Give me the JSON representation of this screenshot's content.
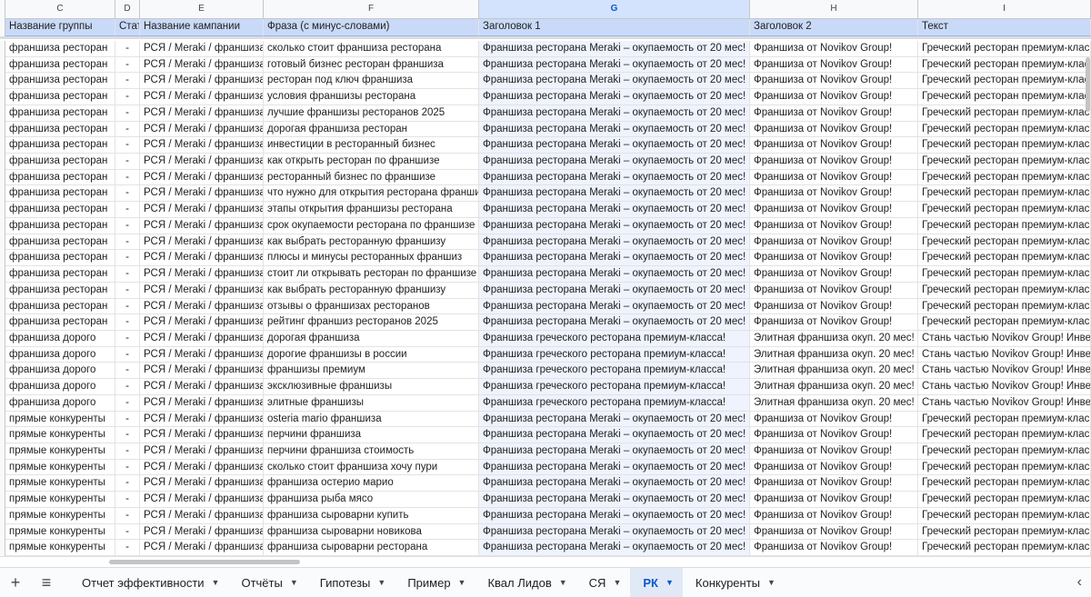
{
  "columns": [
    {
      "letter": "C",
      "header": "Название группы",
      "key": "c"
    },
    {
      "letter": "D",
      "header": "Стат",
      "key": "d"
    },
    {
      "letter": "E",
      "header": "Название кампании",
      "key": "e"
    },
    {
      "letter": "F",
      "header": "Фраза (с минус-словами)",
      "key": "f"
    },
    {
      "letter": "G",
      "header": "Заголовок 1",
      "key": "g"
    },
    {
      "letter": "H",
      "header": "Заголовок 2",
      "key": "h"
    },
    {
      "letter": "I",
      "header": "Текст",
      "key": "i"
    }
  ],
  "selected_column": "G",
  "rows": [
    {
      "c": "франшиза ресторан",
      "d": "-",
      "e": "РСЯ / Meraki / франшиза",
      "f": "сколько стоит франшиза ресторана",
      "g": "Франшиза ресторана Meraki – окупаемость от 20 мес!",
      "h": "Франшиза от Novikov Group!",
      "i": "Греческий ресторан премиум-клас"
    },
    {
      "c": "франшиза ресторан",
      "d": "-",
      "e": "РСЯ / Meraki / франшиза",
      "f": "готовый бизнес ресторан франшиза",
      "g": "Франшиза ресторана Meraki – окупаемость от 20 мес!",
      "h": "Франшиза от Novikov Group!",
      "i": "Греческий ресторан премиум-клас"
    },
    {
      "c": "франшиза ресторан",
      "d": "-",
      "e": "РСЯ / Meraki / франшиза",
      "f": "ресторан под ключ франшиза",
      "g": "Франшиза ресторана Meraki – окупаемость от 20 мес!",
      "h": "Франшиза от Novikov Group!",
      "i": "Греческий ресторан премиум-клас"
    },
    {
      "c": "франшиза ресторан",
      "d": "-",
      "e": "РСЯ / Meraki / франшиза",
      "f": "условия франшизы ресторана",
      "g": "Франшиза ресторана Meraki – окупаемость от 20 мес!",
      "h": "Франшиза от Novikov Group!",
      "i": "Греческий ресторан премиум-клас"
    },
    {
      "c": "франшиза ресторан",
      "d": "-",
      "e": "РСЯ / Meraki / франшиза",
      "f": "лучшие франшизы ресторанов 2025",
      "g": "Франшиза ресторана Meraki – окупаемость от 20 мес!",
      "h": "Франшиза от Novikov Group!",
      "i": "Греческий ресторан премиум-клас"
    },
    {
      "c": "франшиза ресторан",
      "d": "-",
      "e": "РСЯ / Meraki / франшиза",
      "f": "дорогая франшиза ресторан",
      "g": "Франшиза ресторана Meraki – окупаемость от 20 мес!",
      "h": "Франшиза от Novikov Group!",
      "i": "Греческий ресторан премиум-клас"
    },
    {
      "c": "франшиза ресторан",
      "d": "-",
      "e": "РСЯ / Meraki / франшиза",
      "f": "инвестиции в ресторанный бизнес",
      "g": "Франшиза ресторана Meraki – окупаемость от 20 мес!",
      "h": "Франшиза от Novikov Group!",
      "i": "Греческий ресторан премиум-клас"
    },
    {
      "c": "франшиза ресторан",
      "d": "-",
      "e": "РСЯ / Meraki / франшиза",
      "f": "как открыть ресторан по франшизе",
      "g": "Франшиза ресторана Meraki – окупаемость от 20 мес!",
      "h": "Франшиза от Novikov Group!",
      "i": "Греческий ресторан премиум-клас"
    },
    {
      "c": "франшиза ресторан",
      "d": "-",
      "e": "РСЯ / Meraki / франшиза",
      "f": "ресторанный бизнес по франшизе",
      "g": "Франшиза ресторана Meraki – окупаемость от 20 мес!",
      "h": "Франшиза от Novikov Group!",
      "i": "Греческий ресторан премиум-клас"
    },
    {
      "c": "франшиза ресторан",
      "d": "-",
      "e": "РСЯ / Meraki / франшиза",
      "f": "что нужно для открытия ресторана франшиза",
      "g": "Франшиза ресторана Meraki – окупаемость от 20 мес!",
      "h": "Франшиза от Novikov Group!",
      "i": "Греческий ресторан премиум-клас"
    },
    {
      "c": "франшиза ресторан",
      "d": "-",
      "e": "РСЯ / Meraki / франшиза",
      "f": "этапы открытия франшизы ресторана",
      "g": "Франшиза ресторана Meraki – окупаемость от 20 мес!",
      "h": "Франшиза от Novikov Group!",
      "i": "Греческий ресторан премиум-клас"
    },
    {
      "c": "франшиза ресторан",
      "d": "-",
      "e": "РСЯ / Meraki / франшиза",
      "f": "срок окупаемости ресторана по франшизе",
      "g": "Франшиза ресторана Meraki – окупаемость от 20 мес!",
      "h": "Франшиза от Novikov Group!",
      "i": "Греческий ресторан премиум-клас"
    },
    {
      "c": "франшиза ресторан",
      "d": "-",
      "e": "РСЯ / Meraki / франшиза",
      "f": "как выбрать ресторанную франшизу",
      "g": "Франшиза ресторана Meraki – окупаемость от 20 мес!",
      "h": "Франшиза от Novikov Group!",
      "i": "Греческий ресторан премиум-клас"
    },
    {
      "c": "франшиза ресторан",
      "d": "-",
      "e": "РСЯ / Meraki / франшиза",
      "f": "плюсы и минусы ресторанных франшиз",
      "g": "Франшиза ресторана Meraki – окупаемость от 20 мес!",
      "h": "Франшиза от Novikov Group!",
      "i": "Греческий ресторан премиум-клас"
    },
    {
      "c": "франшиза ресторан",
      "d": "-",
      "e": "РСЯ / Meraki / франшиза",
      "f": "стоит ли открывать ресторан по франшизе",
      "g": "Франшиза ресторана Meraki – окупаемость от 20 мес!",
      "h": "Франшиза от Novikov Group!",
      "i": "Греческий ресторан премиум-клас"
    },
    {
      "c": "франшиза ресторан",
      "d": "-",
      "e": "РСЯ / Meraki / франшиза",
      "f": "как выбрать ресторанную франшизу",
      "g": "Франшиза ресторана Meraki – окупаемость от 20 мес!",
      "h": "Франшиза от Novikov Group!",
      "i": "Греческий ресторан премиум-клас"
    },
    {
      "c": "франшиза ресторан",
      "d": "-",
      "e": "РСЯ / Meraki / франшиза",
      "f": "отзывы о франшизах ресторанов",
      "g": "Франшиза ресторана Meraki – окупаемость от 20 мес!",
      "h": "Франшиза от Novikov Group!",
      "i": "Греческий ресторан премиум-клас"
    },
    {
      "c": "франшиза ресторан",
      "d": "-",
      "e": "РСЯ / Meraki / франшиза",
      "f": "рейтинг франшиз ресторанов 2025",
      "g": "Франшиза ресторана Meraki – окупаемость от 20 мес!",
      "h": "Франшиза от Novikov Group!",
      "i": "Греческий ресторан премиум-клас"
    },
    {
      "c": "франшиза дорого",
      "d": "-",
      "e": "РСЯ / Meraki / франшиза",
      "f": "дорогая франшиза",
      "g": "Франшиза греческого ресторана премиум-класса!",
      "h": "Элитная франшиза окуп. 20 мес!",
      "i": "Стань частью Novikov Group! Инве"
    },
    {
      "c": "франшиза дорого",
      "d": "-",
      "e": "РСЯ / Meraki / франшиза",
      "f": "дорогие франшизы в россии",
      "g": "Франшиза греческого ресторана премиум-класса!",
      "h": "Элитная франшиза окуп. 20 мес!",
      "i": "Стань частью Novikov Group! Инве"
    },
    {
      "c": "франшиза дорого",
      "d": "-",
      "e": "РСЯ / Meraki / франшиза",
      "f": "франшизы премиум",
      "g": "Франшиза греческого ресторана премиум-класса!",
      "h": "Элитная франшиза окуп. 20 мес!",
      "i": "Стань частью Novikov Group! Инве"
    },
    {
      "c": "франшиза дорого",
      "d": "-",
      "e": "РСЯ / Meraki / франшиза",
      "f": "эксклюзивные франшизы",
      "g": "Франшиза греческого ресторана премиум-класса!",
      "h": "Элитная франшиза окуп. 20 мес!",
      "i": "Стань частью Novikov Group! Инве"
    },
    {
      "c": "франшиза дорого",
      "d": "-",
      "e": "РСЯ / Meraki / франшиза",
      "f": "элитные франшизы",
      "g": "Франшиза греческого ресторана премиум-класса!",
      "h": "Элитная франшиза окуп. 20 мес!",
      "i": "Стань частью Novikov Group! Инве"
    },
    {
      "c": "прямые конкуренты",
      "d": "-",
      "e": "РСЯ / Meraki / франшиза",
      "f": "osteria mario франшиза",
      "g": "Франшиза ресторана Meraki – окупаемость от 20 мес!",
      "h": "Франшиза от Novikov Group!",
      "i": "Греческий ресторан премиум-клас"
    },
    {
      "c": "прямые конкуренты",
      "d": "-",
      "e": "РСЯ / Meraki / франшиза",
      "f": "перчини франшиза",
      "g": "Франшиза ресторана Meraki – окупаемость от 20 мес!",
      "h": "Франшиза от Novikov Group!",
      "i": "Греческий ресторан премиум-клас"
    },
    {
      "c": "прямые конкуренты",
      "d": "-",
      "e": "РСЯ / Meraki / франшиза",
      "f": "перчини франшиза стоимость",
      "g": "Франшиза ресторана Meraki – окупаемость от 20 мес!",
      "h": "Франшиза от Novikov Group!",
      "i": "Греческий ресторан премиум-клас"
    },
    {
      "c": "прямые конкуренты",
      "d": "-",
      "e": "РСЯ / Meraki / франшиза",
      "f": "сколько стоит франшиза хочу пури",
      "g": "Франшиза ресторана Meraki – окупаемость от 20 мес!",
      "h": "Франшиза от Novikov Group!",
      "i": "Греческий ресторан премиум-клас"
    },
    {
      "c": "прямые конкуренты",
      "d": "-",
      "e": "РСЯ / Meraki / франшиза",
      "f": "франшиза остерио марио",
      "g": "Франшиза ресторана Meraki – окупаемость от 20 мес!",
      "h": "Франшиза от Novikov Group!",
      "i": "Греческий ресторан премиум-клас"
    },
    {
      "c": "прямые конкуренты",
      "d": "-",
      "e": "РСЯ / Meraki / франшиза",
      "f": "франшиза рыба мясо",
      "g": "Франшиза ресторана Meraki – окупаемость от 20 мес!",
      "h": "Франшиза от Novikov Group!",
      "i": "Греческий ресторан премиум-клас"
    },
    {
      "c": "прямые конкуренты",
      "d": "-",
      "e": "РСЯ / Meraki / франшиза",
      "f": "франшиза сыроварни купить",
      "g": "Франшиза ресторана Meraki – окупаемость от 20 мес!",
      "h": "Франшиза от Novikov Group!",
      "i": "Греческий ресторан премиум-клас"
    },
    {
      "c": "прямые конкуренты",
      "d": "-",
      "e": "РСЯ / Meraki / франшиза",
      "f": "франшиза сыроварни новикова",
      "g": "Франшиза ресторана Meraki – окупаемость от 20 мес!",
      "h": "Франшиза от Novikov Group!",
      "i": "Греческий ресторан премиум-клас"
    },
    {
      "c": "прямые конкуренты",
      "d": "-",
      "e": "РСЯ / Meraki / франшиза",
      "f": "франшиза сыроварни ресторана",
      "g": "Франшиза ресторана Meraki – окупаемость от 20 мес!",
      "h": "Франшиза от Novikov Group!",
      "i": "Греческий ресторан премиум-клас"
    }
  ],
  "tabs": [
    {
      "label": "Отчет эффективности",
      "active": false
    },
    {
      "label": "Отчёты",
      "active": false
    },
    {
      "label": "Гипотезы",
      "active": false
    },
    {
      "label": "Пример",
      "active": false
    },
    {
      "label": "Квал Лидов",
      "active": false
    },
    {
      "label": "СЯ",
      "active": false
    },
    {
      "label": "РК",
      "active": true
    },
    {
      "label": "Конкуренты",
      "active": false
    }
  ],
  "toolbar": {
    "add_icon": "plus-icon",
    "all_sheets_icon": "menu-icon",
    "nav_icon": "chevron-left-icon"
  },
  "colors": {
    "header_fill": "#c9daf8",
    "selected_col": "#d3e3fd",
    "active_tab": "#0b57d0"
  }
}
